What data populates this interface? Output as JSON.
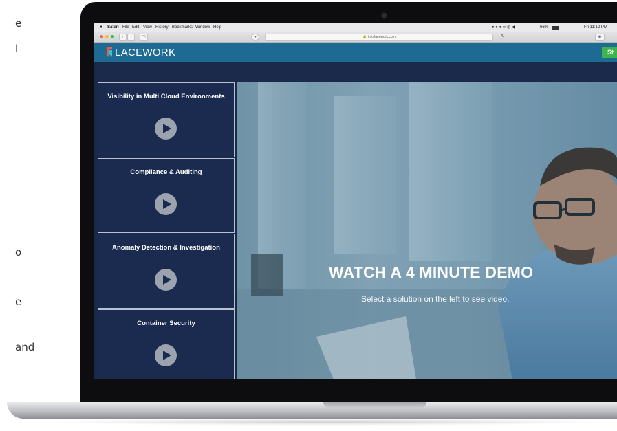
{
  "page": {
    "left_text": [
      "e",
      "l",
      "o",
      "e",
      "and"
    ]
  },
  "menubar": {
    "items": [
      "Safari",
      "File",
      "Edit",
      "View",
      "History",
      "Bookmarks",
      "Window",
      "Help"
    ],
    "clock": "Fri 11:12 PM",
    "battery": "66%"
  },
  "browser": {
    "url": "info.lacework.com"
  },
  "site": {
    "logo": "LACEWORK",
    "cta_label": "St",
    "brand_color": "#1d6a92"
  },
  "sidebar": {
    "items": [
      {
        "label": "Visibility in Multi Cloud Environments"
      },
      {
        "label": "Compliance & Auditing"
      },
      {
        "label": "Anomaly Detection & Investigation"
      },
      {
        "label": "Container Security"
      }
    ]
  },
  "hero": {
    "title": "WATCH A 4 MINUTE DEMO",
    "subtitle": "Select a solution on the left to see video."
  }
}
